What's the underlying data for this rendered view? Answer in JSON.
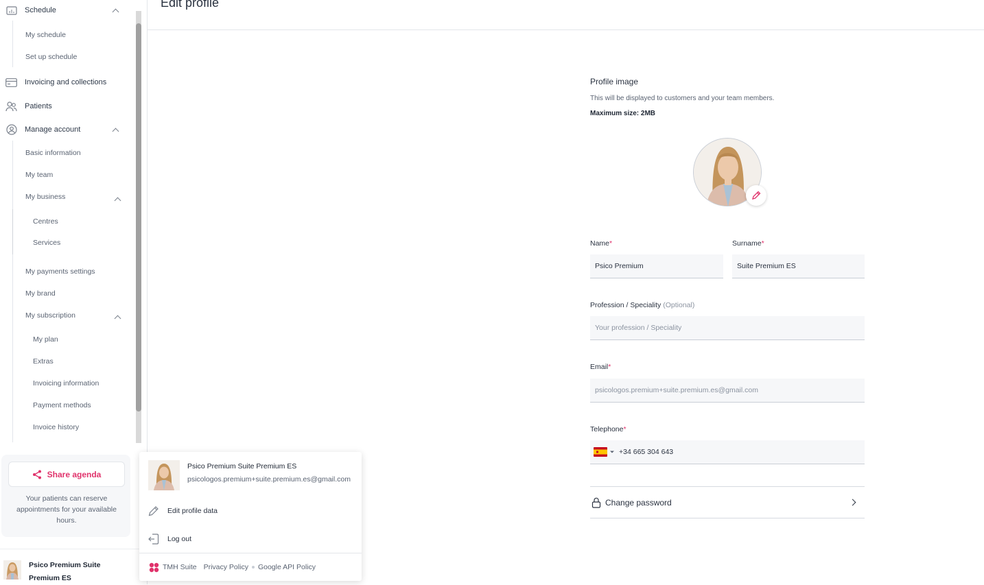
{
  "header": {
    "title": "Edit profile"
  },
  "sidebar": {
    "schedule_label": "Schedule",
    "schedule_items": [
      "My schedule",
      "Set up schedule"
    ],
    "invoicing_label": "Invoicing and collections",
    "patients_label": "Patients",
    "manage_account_label": "Manage account",
    "account_items": {
      "basic_info": "Basic information",
      "my_team": "My team",
      "my_business": "My business",
      "centres": "Centres",
      "services": "Services",
      "payments_settings": "My payments settings",
      "my_brand": "My brand",
      "my_subscription": "My subscription",
      "my_plan": "My plan",
      "extras": "Extras",
      "invoicing_information": "Invoicing information",
      "payment_methods": "Payment methods",
      "invoice_history": "Invoice history"
    },
    "share": {
      "button_label": "Share agenda",
      "description": "Your patients can reserve appointments for your available hours."
    },
    "user": {
      "name": "Psico Premium Suite Premium ES"
    }
  },
  "profile_image": {
    "title": "Profile image",
    "description": "This will be displayed to customers and your team members.",
    "max_size": "Maximum size: 2MB"
  },
  "form": {
    "name_label": "Name",
    "name_value": "Psico Premium",
    "surname_label": "Surname",
    "surname_value": "Suite Premium ES",
    "profession_label": "Profession / Speciality",
    "profession_optional": "(Optional)",
    "profession_placeholder": "Your profession / Speciality",
    "email_label": "Email",
    "email_value": "psicologos.premium+suite.premium.es@gmail.com",
    "telephone_label": "Telephone",
    "telephone_value": "+34 665 304 643",
    "required_mark": "*",
    "change_password_label": "Change password"
  },
  "popup": {
    "user_name": "Psico Premium Suite Premium ES",
    "user_email": "psicologos.premium+suite.premium.es@gmail.com",
    "edit_profile_label": "Edit profile data",
    "logout_label": "Log out",
    "footer": {
      "brand": "TMH Suite",
      "privacy": "Privacy Policy",
      "google_api": "Google API Policy"
    }
  },
  "colors": {
    "accent": "#e0326b",
    "text": "#2a3240",
    "muted": "#8b93a0"
  }
}
